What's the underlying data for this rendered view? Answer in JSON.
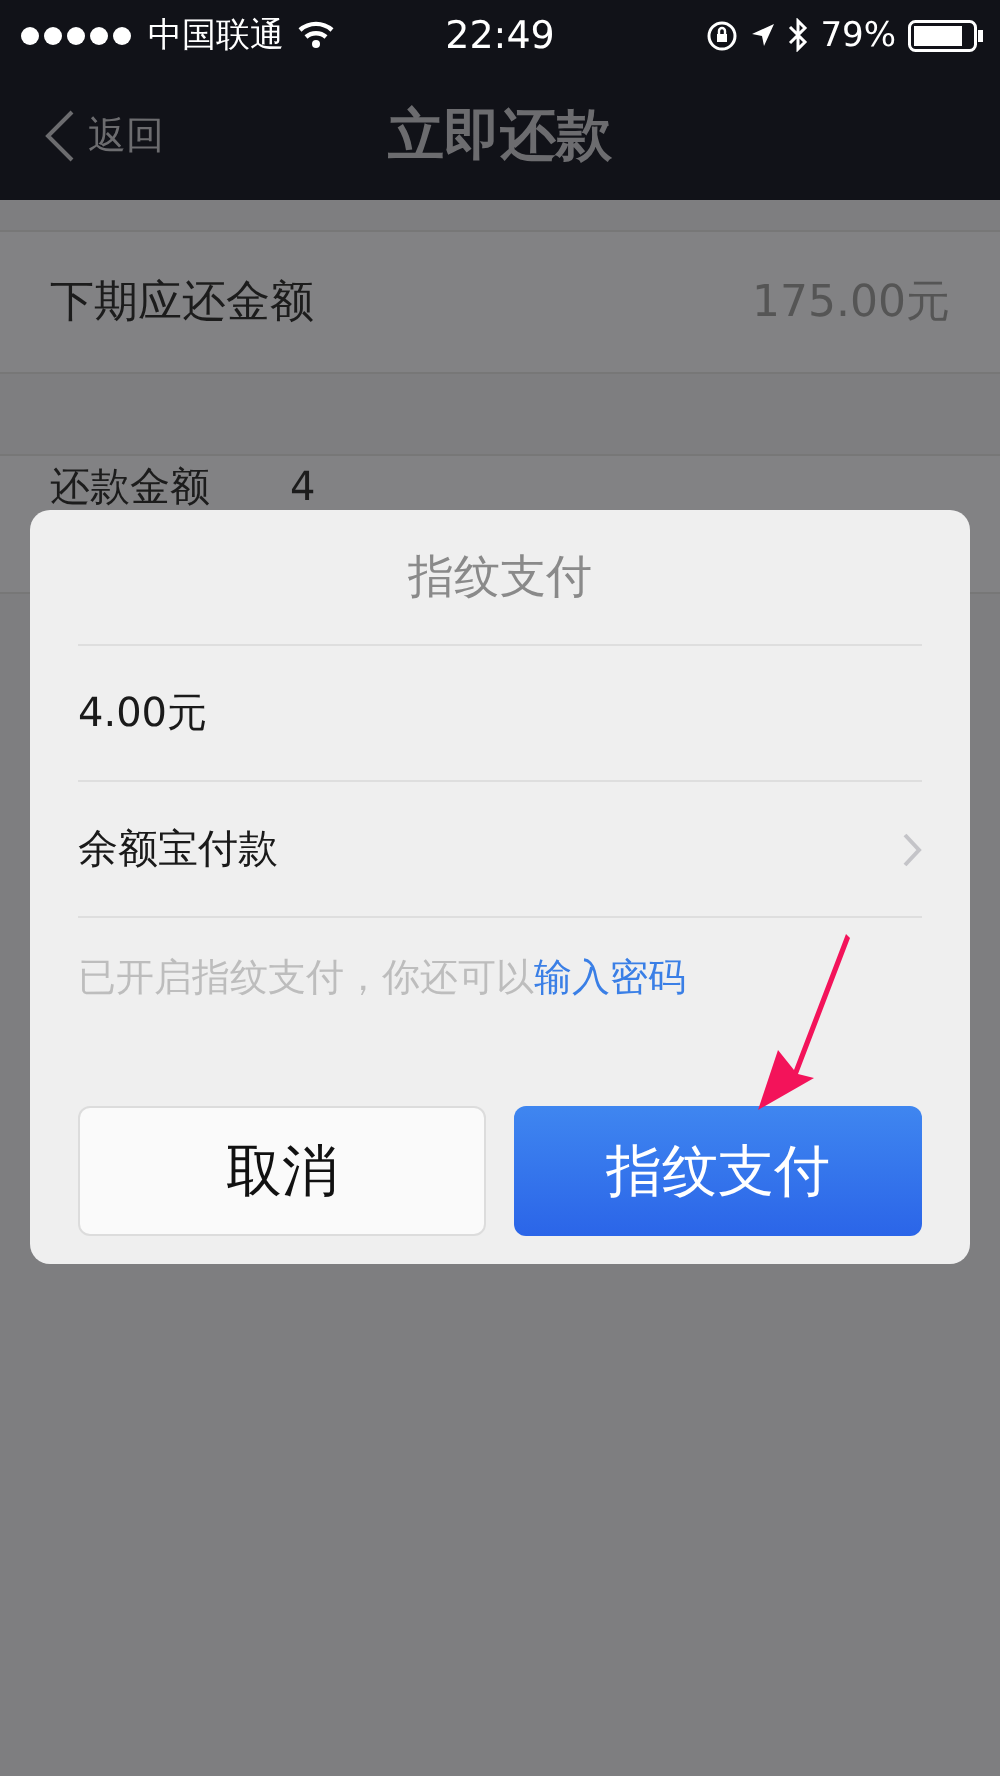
{
  "status_bar": {
    "carrier": "中国联通",
    "time": "22:49",
    "battery_text": "79%"
  },
  "nav": {
    "back": "返回",
    "title": "立即还款"
  },
  "rows": [
    {
      "label": "下期应还金额",
      "value": "175.00元"
    },
    {
      "label": "还款金额",
      "value": "4"
    }
  ],
  "dialog": {
    "title": "指纹支付",
    "amount": "4.00元",
    "method": "余额宝付款",
    "hint": "已开启指纹支付，你还可以",
    "hint_link": "输入密码",
    "buttons": [
      {
        "label": "取消",
        "kind": "secondary"
      },
      {
        "label": "指纹支付",
        "kind": "primary"
      }
    ]
  }
}
